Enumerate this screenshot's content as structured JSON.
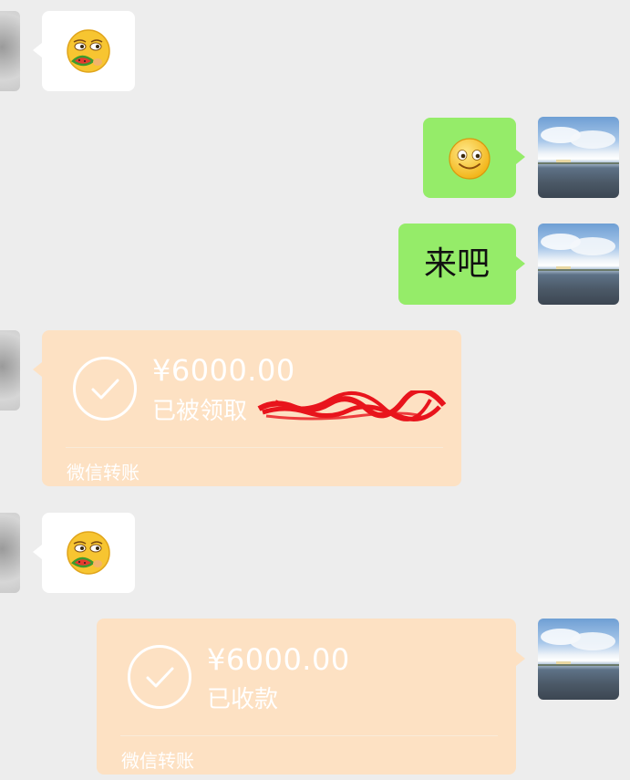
{
  "messages": [
    {
      "side": "left",
      "type": "emoji",
      "emoji": "smug-watermelon-face-icon"
    },
    {
      "side": "right",
      "type": "emoji",
      "emoji": "smile-face-icon"
    },
    {
      "side": "right",
      "type": "text",
      "text": "来吧"
    },
    {
      "side": "left",
      "type": "transfer",
      "amount": "¥6000.00",
      "status": "已被领取",
      "label": "微信转账"
    },
    {
      "side": "left",
      "type": "emoji",
      "emoji": "smug-watermelon-face-icon"
    },
    {
      "side": "right",
      "type": "transfer",
      "amount": "¥6000.00",
      "status": "已收款",
      "label": "微信转账"
    }
  ],
  "colors": {
    "background": "#ededed",
    "green_bubble": "#95ec69",
    "transfer_bubble": "#fde1c3",
    "redaction": "#e8141c"
  }
}
